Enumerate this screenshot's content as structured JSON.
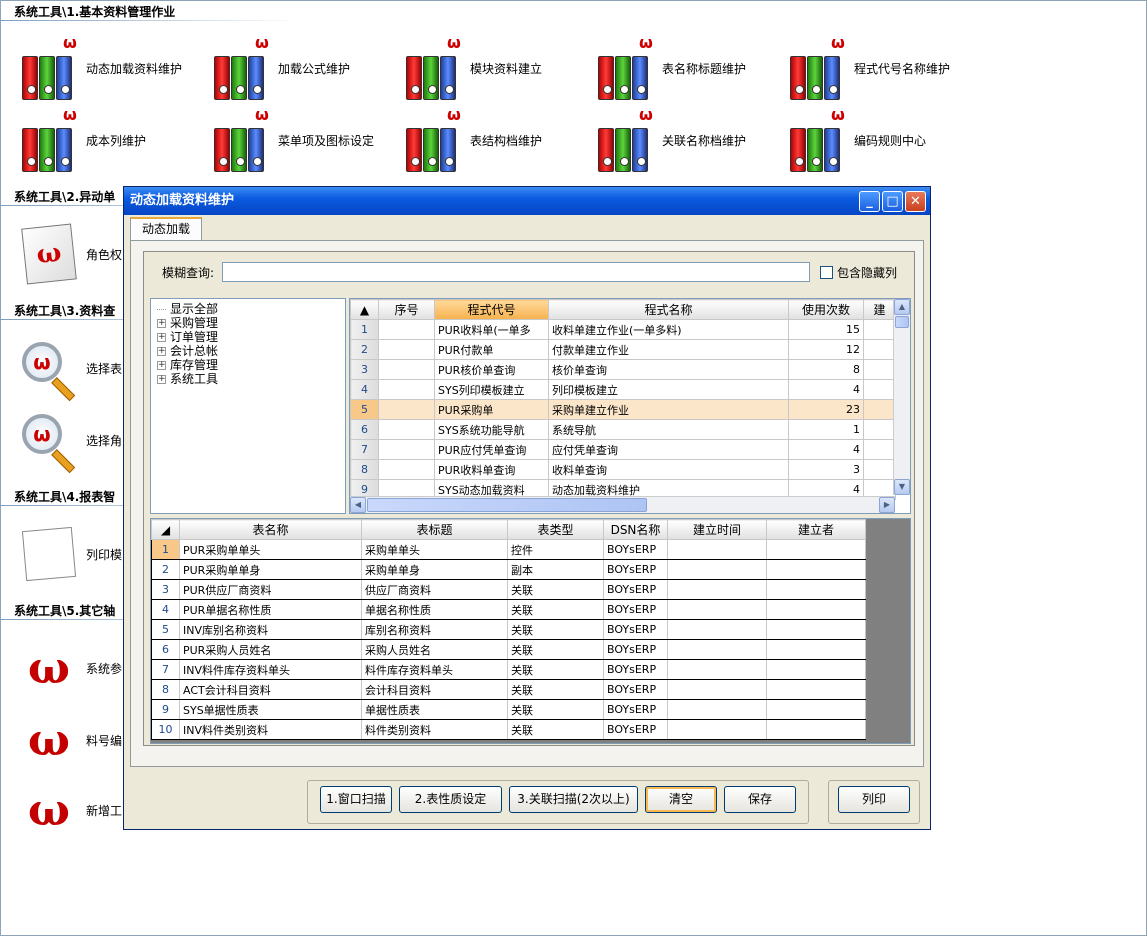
{
  "sections": [
    {
      "title": "系统工具\\1.基本资料管理作业"
    },
    {
      "title": "系统工具\\2.异动单"
    },
    {
      "title": "系统工具\\3.资料查"
    },
    {
      "title": "系统工具\\4.报表智"
    },
    {
      "title": "系统工具\\5.其它轴"
    }
  ],
  "modules_row1": [
    "动态加载资料维护",
    "加载公式维护",
    "模块资料建立",
    "表名称标题维护",
    "程式代号名称维护"
  ],
  "modules_row2": [
    "成本列维护",
    "菜单项及图标设定",
    "表结构档维护",
    "关联名称档维护",
    "编码规则中心"
  ],
  "left_modules": [
    "角色权",
    "选择表",
    "选择角",
    "列印模",
    "系统参",
    "料号编",
    "新增工"
  ],
  "dialog": {
    "title": "动态加载资料维护",
    "tab": "动态加载",
    "search_label": "模糊查询:",
    "search_value": "",
    "include_hidden": "包含隐藏列",
    "tree": [
      "显示全部",
      "采购管理",
      "订单管理",
      "会计总帐",
      "库存管理",
      "系统工具"
    ],
    "grid1": {
      "columns": [
        "序号",
        "程式代号",
        "程式名称",
        "使用次数",
        "建"
      ],
      "rows": [
        [
          "1",
          "",
          "PUR收料单(一单多",
          "收料单建立作业(一单多料)",
          "15"
        ],
        [
          "2",
          "",
          "PUR付款单",
          "付款单建立作业",
          "12"
        ],
        [
          "3",
          "",
          "PUR核价单查询",
          "核价单查询",
          "8"
        ],
        [
          "4",
          "",
          "SYS列印模板建立",
          "列印模板建立",
          "4"
        ],
        [
          "5",
          "",
          "PUR采购单",
          "采购单建立作业",
          "23"
        ],
        [
          "6",
          "",
          "SYS系统功能导航",
          "系统导航",
          "1"
        ],
        [
          "7",
          "",
          "PUR应付凭单查询",
          "应付凭单查询",
          "4"
        ],
        [
          "8",
          "",
          "PUR收料单查询",
          "收料单查询",
          "3"
        ],
        [
          "9",
          "",
          "SYS动态加载资料",
          "动态加载资料维护",
          "4"
        ]
      ],
      "selected_row": 5
    },
    "grid2": {
      "columns": [
        "表名称",
        "表标题",
        "表类型",
        "DSN名称",
        "建立时间",
        "建立者"
      ],
      "rows": [
        [
          "1",
          "PUR采购单单头",
          "采购单单头",
          "控件",
          "BOYsERP",
          "",
          ""
        ],
        [
          "2",
          "PUR采购单单身",
          "采购单单身",
          "副本",
          "BOYsERP",
          "",
          ""
        ],
        [
          "3",
          "PUR供应厂商资料",
          "供应厂商资料",
          "关联",
          "BOYsERP",
          "",
          ""
        ],
        [
          "4",
          "PUR单据名称性质",
          "单据名称性质",
          "关联",
          "BOYsERP",
          "",
          ""
        ],
        [
          "5",
          "INV库别名称资料",
          "库别名称资料",
          "关联",
          "BOYsERP",
          "",
          ""
        ],
        [
          "6",
          "PUR采购人员姓名",
          "采购人员姓名",
          "关联",
          "BOYsERP",
          "",
          ""
        ],
        [
          "7",
          "INV料件库存资料单头",
          "料件库存资料单头",
          "关联",
          "BOYsERP",
          "",
          ""
        ],
        [
          "8",
          "ACT会计科目资料",
          "会计科目资料",
          "关联",
          "BOYsERP",
          "",
          ""
        ],
        [
          "9",
          "SYS单据性质表",
          "单据性质表",
          "关联",
          "BOYsERP",
          "",
          ""
        ],
        [
          "10",
          "INV料件类别资料",
          "料件类别资料",
          "关联",
          "BOYsERP",
          "",
          ""
        ]
      ]
    },
    "buttons": {
      "scan": "1.窗口扫描",
      "props": "2.表性质设定",
      "rel": "3.关联扫描(2次以上)",
      "clear": "清空",
      "save": "保存",
      "print": "列印"
    }
  }
}
